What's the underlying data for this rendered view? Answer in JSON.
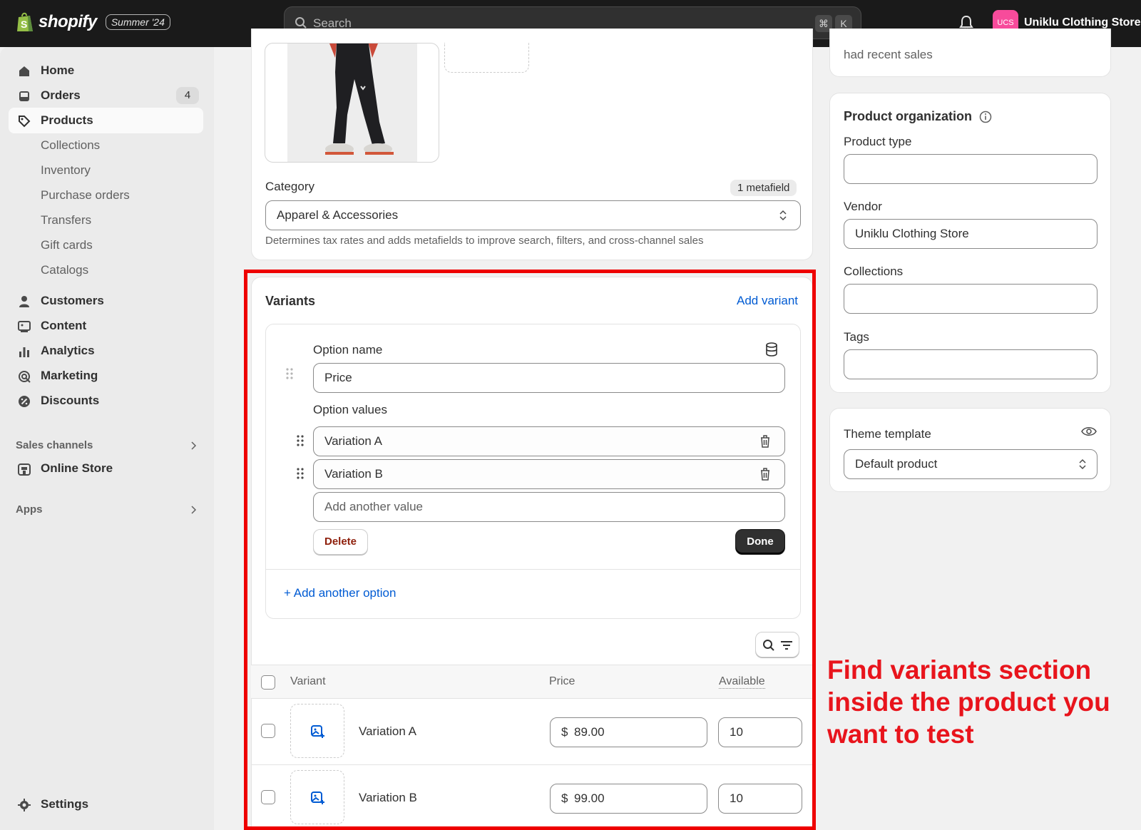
{
  "topbar": {
    "brand": "shopify",
    "edition": "Summer '24",
    "search_placeholder": "Search",
    "shortcut_cmd": "⌘",
    "shortcut_key": "K",
    "store_initials": "UCS",
    "store_name": "Uniklu Clothing Store"
  },
  "sidebar": {
    "home": "Home",
    "orders": "Orders",
    "orders_badge": "4",
    "products": "Products",
    "collections": "Collections",
    "inventory": "Inventory",
    "purchase_orders": "Purchase orders",
    "transfers": "Transfers",
    "gift_cards": "Gift cards",
    "catalogs": "Catalogs",
    "customers": "Customers",
    "content": "Content",
    "analytics": "Analytics",
    "marketing": "Marketing",
    "discounts": "Discounts",
    "sales_channels": "Sales channels",
    "online_store": "Online Store",
    "apps": "Apps",
    "settings": "Settings"
  },
  "product": {
    "category_label": "Category",
    "metafield_pill": "1 metafield",
    "category_value": "Apparel & Accessories",
    "category_help": "Determines tax rates and adds metafields to improve search, filters, and cross-channel sales"
  },
  "variants": {
    "title": "Variants",
    "add_variant": "Add variant",
    "option_name_label": "Option name",
    "option_name_value": "Price",
    "option_values_label": "Option values",
    "values": [
      "Variation A",
      "Variation B"
    ],
    "add_value_placeholder": "Add another value",
    "delete_label": "Delete",
    "done_label": "Done",
    "add_option": "Add another option",
    "columns": {
      "variant": "Variant",
      "price": "Price",
      "available": "Available"
    },
    "rows": [
      {
        "name": "Variation A",
        "currency": "$",
        "price": "89.00",
        "available": "10"
      },
      {
        "name": "Variation B",
        "currency": "$",
        "price": "99.00",
        "available": "10"
      }
    ]
  },
  "right": {
    "recent_sales_text": "had recent sales",
    "org_title": "Product organization",
    "product_type_label": "Product type",
    "vendor_label": "Vendor",
    "vendor_value": "Uniklu Clothing Store",
    "collections_label": "Collections",
    "tags_label": "Tags",
    "theme_label": "Theme template",
    "theme_value": "Default product"
  },
  "annotation": {
    "text": "Find variants section inside the product you want to test",
    "color": "#e8141c"
  }
}
